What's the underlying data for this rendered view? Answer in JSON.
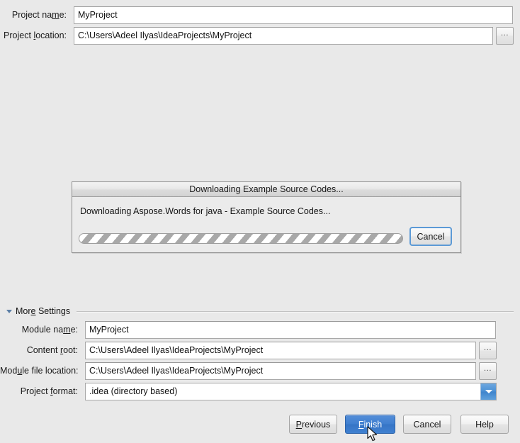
{
  "window": {
    "background_color": "#e9e9e9"
  },
  "top_form": {
    "project_name": {
      "label_pre": "Project na",
      "label_mnemonic": "m",
      "label_post": "e:",
      "value": "MyProject"
    },
    "project_location": {
      "label_pre": "Project ",
      "label_mnemonic": "l",
      "label_post": "ocation:",
      "value": "C:\\Users\\Adeel Ilyas\\IdeaProjects\\MyProject",
      "browse_label": "..."
    }
  },
  "more_settings": {
    "label_pre": "Mor",
    "label_mnemonic": "e",
    "label_post": " Settings",
    "expanded_icon": "triangle-down-icon",
    "module_name": {
      "label_pre": "Module na",
      "label_mnemonic": "m",
      "label_post": "e:",
      "value": "MyProject"
    },
    "content_root": {
      "label_pre": "Content ",
      "label_mnemonic": "r",
      "label_post": "oot:",
      "value": "C:\\Users\\Adeel Ilyas\\IdeaProjects\\MyProject",
      "browse_label": "..."
    },
    "module_file_location": {
      "label_pre": "Mod",
      "label_mnemonic": "u",
      "label_post": "le file location:",
      "value": "C:\\Users\\Adeel Ilyas\\IdeaProjects\\MyProject",
      "browse_label": "..."
    },
    "project_format": {
      "label_pre": "Project ",
      "label_mnemonic": "f",
      "label_post": "ormat:",
      "selected": ".idea (directory based)",
      "arrow_icon": "chevron-down-icon",
      "accent_color": "#4a8fd4"
    }
  },
  "progress_dialog": {
    "title": "Downloading Example Source Codes...",
    "message": "Downloading Aspose.Words for java - Example Source Codes...",
    "progress_bar": {
      "indeterminate": true,
      "stripe_color": "#a8a8a8",
      "track_color": "#ffffff"
    },
    "cancel_label": "Cancel",
    "cancel_focus_color": "#5c9ad6"
  },
  "buttons": {
    "previous": {
      "label_pre": "",
      "label_mnemonic": "P",
      "label_post": "revious"
    },
    "finish": {
      "label_pre": "",
      "label_mnemonic": "F",
      "label_post": "inish",
      "is_default": true,
      "accent_color": "#3f7fd0"
    },
    "cancel": {
      "label_pre": "Cancel",
      "label_mnemonic": "",
      "label_post": ""
    },
    "help": {
      "label_pre": "Help",
      "label_mnemonic": "",
      "label_post": ""
    }
  },
  "cursor": {
    "icon": "arrow-cursor-icon"
  }
}
